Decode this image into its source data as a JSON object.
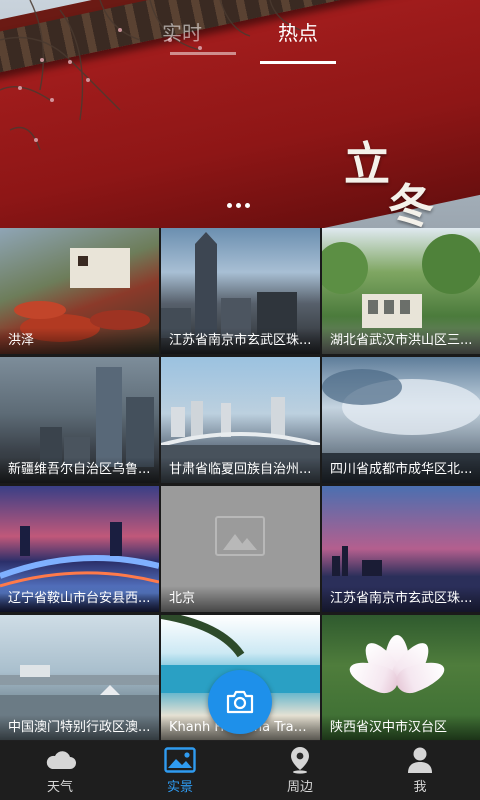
{
  "header": {
    "tabs": [
      {
        "label": "实时",
        "active": false
      },
      {
        "label": "热点",
        "active": true
      }
    ],
    "banner_text": [
      "立",
      "冬"
    ],
    "page_indicator_count": 3
  },
  "grid": [
    {
      "label": "洪泽"
    },
    {
      "label": "江苏省南京市玄武区珠..."
    },
    {
      "label": "湖北省武汉市洪山区三..."
    },
    {
      "label": "新疆维吾尔自治区乌鲁..."
    },
    {
      "label": "甘肃省临夏回族自治州..."
    },
    {
      "label": "四川省成都市成华区北..."
    },
    {
      "label": "辽宁省鞍山市台安县西..."
    },
    {
      "label": "北京"
    },
    {
      "label": "江苏省南京市玄武区珠..."
    },
    {
      "label": "中国澳门特别行政区澳..."
    },
    {
      "label": "Khanh Hoa Nha Trang T..."
    },
    {
      "label": "陕西省汉中市汉台区"
    }
  ],
  "bottom_nav": [
    {
      "label": "天气",
      "icon": "cloud-icon",
      "active": false
    },
    {
      "label": "实景",
      "icon": "photo-icon",
      "active": true
    },
    {
      "label": "周边",
      "icon": "location-pin-icon",
      "active": false
    },
    {
      "label": "我",
      "icon": "user-icon",
      "active": false
    }
  ],
  "colors": {
    "accent": "#2f9bf0",
    "camera_button": "#1e90ea"
  }
}
